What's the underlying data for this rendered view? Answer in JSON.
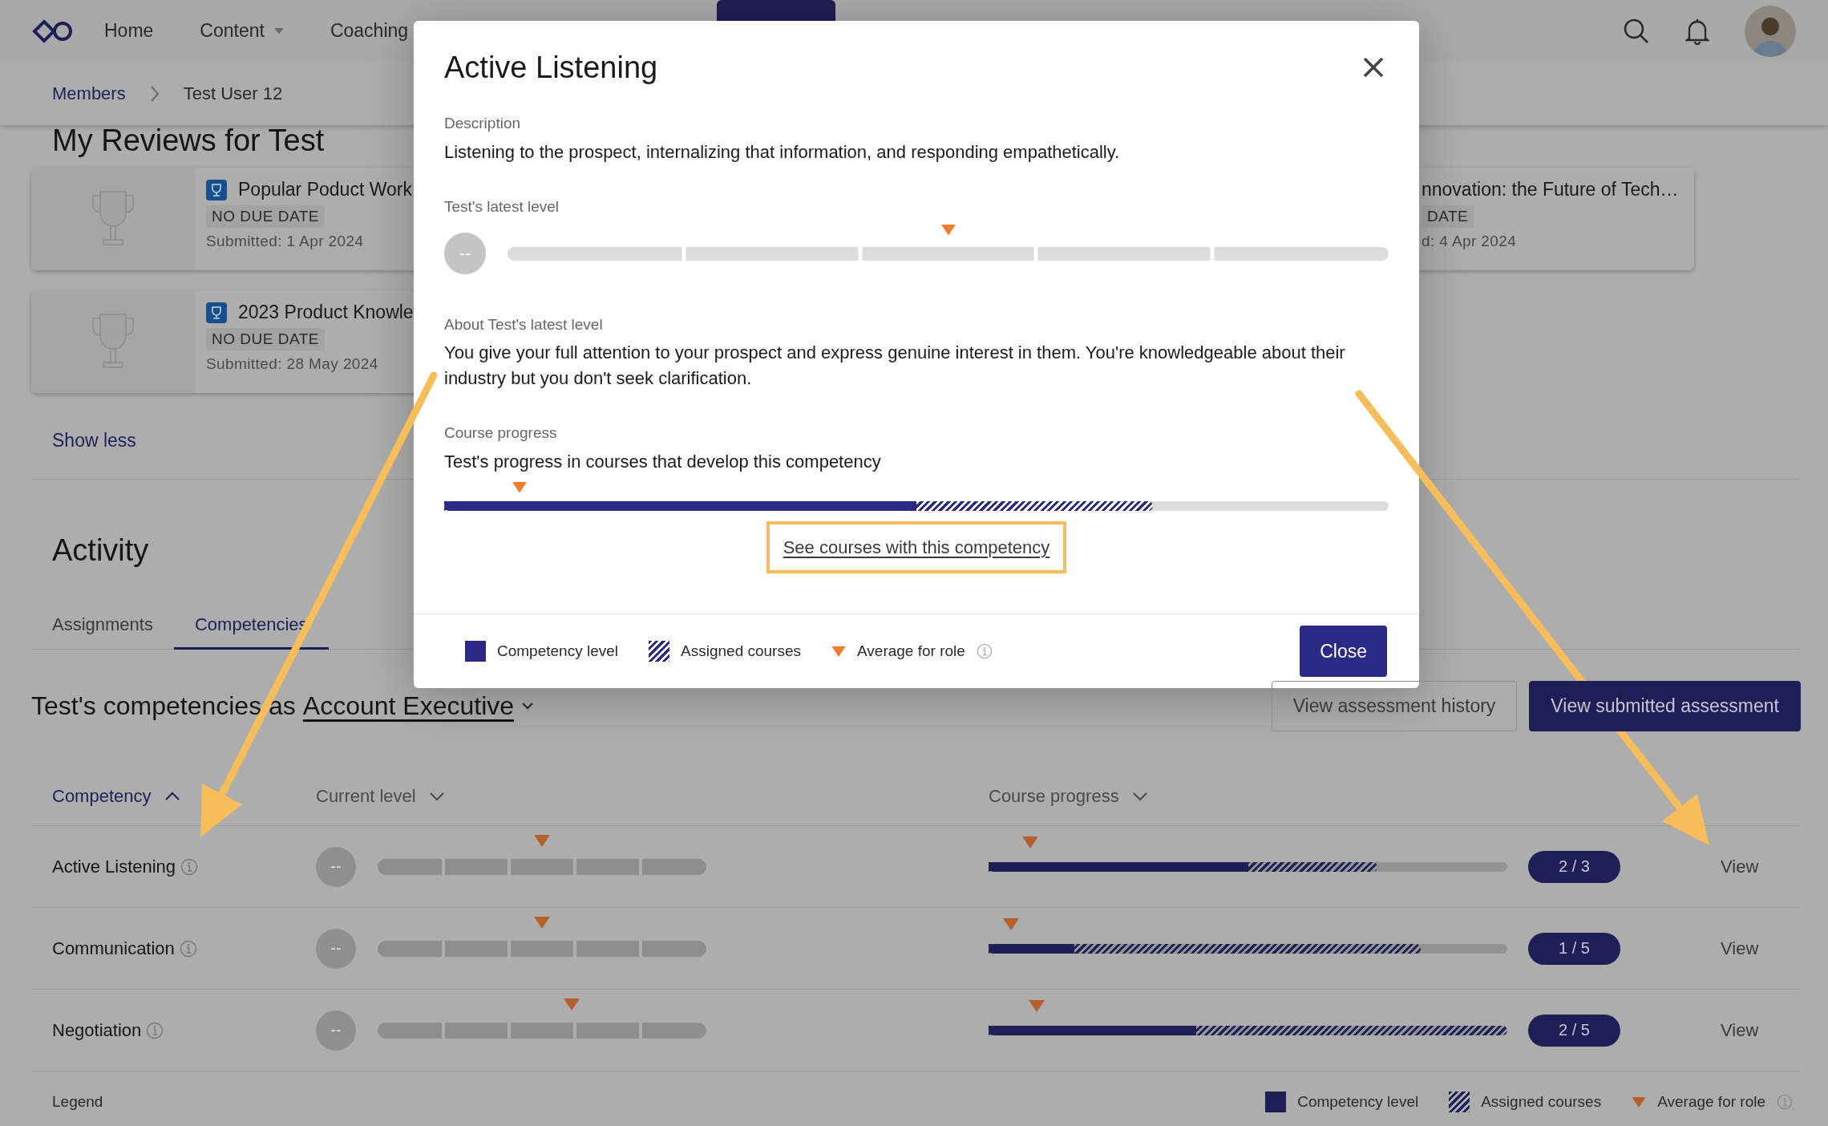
{
  "nav": {
    "links": [
      {
        "label": "Home",
        "dropdown": false
      },
      {
        "label": "Content",
        "dropdown": true
      },
      {
        "label": "Coaching",
        "dropdown": false
      }
    ]
  },
  "breadcrumb": [
    "Members",
    "Test User 12"
  ],
  "reviews": {
    "title": "My Reviews for Test",
    "cards": [
      {
        "title": "Popular Poduct Work",
        "tag": "NO DUE DATE",
        "submitted": "Submitted: 1 Apr 2024"
      },
      {
        "title": "2023 Product Knowle",
        "tag": "NO DUE DATE",
        "submitted": "Submitted: 28 May 2024"
      }
    ],
    "side_card": {
      "title": "nnovation: the Future of Tech…",
      "tag": "DATE",
      "submitted": "d: 4 Apr 2024"
    },
    "toggle": "Show less"
  },
  "activity": {
    "title": "Activity",
    "tabs": [
      {
        "label": "Assignments",
        "selected": false
      },
      {
        "label": "Competencies",
        "selected": true
      }
    ]
  },
  "competencies": {
    "heading": "Test's competencies as",
    "role": "Account Executive",
    "buttons": [
      {
        "label": "View assessment history",
        "kind": "outline"
      },
      {
        "label": "View submitted assessment",
        "kind": "primary"
      }
    ],
    "columns": [
      {
        "label": "Competency",
        "selected": true
      },
      {
        "label": "Current level",
        "selected": false
      },
      {
        "label": "Course progress",
        "selected": false
      }
    ],
    "rows": [
      {
        "name": "Active Listening",
        "level_text": "--",
        "average": {
          "level": 0.5
        },
        "completed": {
          "level": 0.5
        },
        "assigned": {
          "level": 0.75
        },
        "course_average": {
          "level": 0.08
        },
        "count": "2 / 3",
        "action": "View"
      },
      {
        "name": "Communication",
        "level_text": "--",
        "average": {
          "level": 0.5
        },
        "completed": {
          "level": 0.165
        },
        "assigned": {
          "level": 0.833
        },
        "course_average": {
          "level": 0.043
        },
        "count": "1 / 5",
        "action": "View"
      },
      {
        "name": "Negotiation",
        "level_text": "--",
        "average": {
          "level": 0.59
        },
        "completed": {
          "level": 0.4
        },
        "assigned": {
          "level": 1.0
        },
        "course_average": {
          "level": 0.092
        },
        "count": "2 / 5",
        "action": "View"
      }
    ],
    "legend": {
      "title": "Legend",
      "items": [
        {
          "kind": "solid",
          "label": "Competency level"
        },
        {
          "kind": "hatched",
          "label": "Assigned courses"
        },
        {
          "kind": "marker",
          "label": "Average for role"
        }
      ]
    }
  },
  "modal": {
    "title": "Active Listening",
    "description_label": "Description",
    "description": "Listening to the prospect, internalizing that information, and responding empathetically.",
    "level_label": "Test's latest level",
    "level_text": "--",
    "average": {
      "level": 0.5
    },
    "about_label": "About Test's latest level",
    "about": "You give your full attention to your prospect and express genuine interest in them. You're knowledgeable about their industry but you don't seek clarification.",
    "course_label": "Course progress",
    "course_text": "Test's progress in courses that develop this competency",
    "completed": {
      "level": 0.5
    },
    "assigned": {
      "level": 0.75
    },
    "course_average": {
      "level": 0.08
    },
    "link": "See courses with this competency",
    "legend": [
      {
        "kind": "solid",
        "label": "Competency level"
      },
      {
        "kind": "hatched",
        "label": "Assigned courses"
      },
      {
        "kind": "marker",
        "label": "Average for role"
      }
    ],
    "close": "Close"
  }
}
